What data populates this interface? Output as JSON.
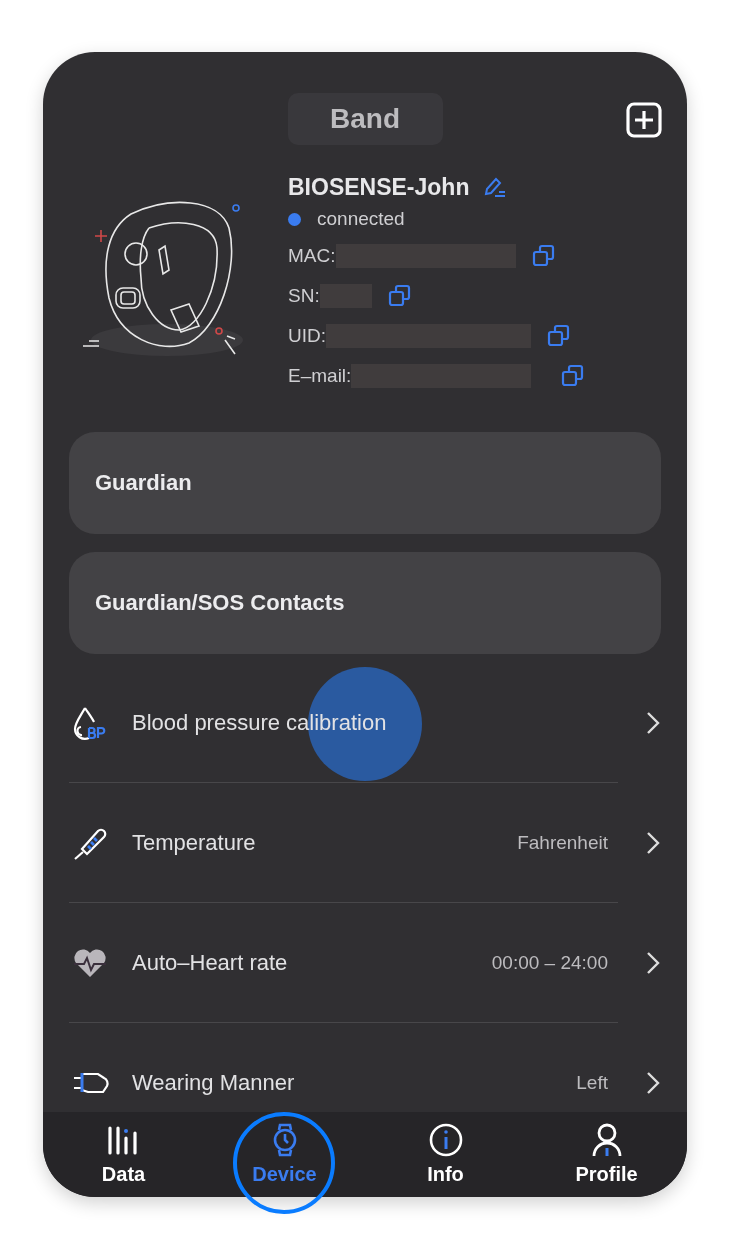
{
  "header": {
    "title": "Band"
  },
  "device": {
    "name": "BIOSENSE-John",
    "status": "connected",
    "connected": true,
    "fields": [
      {
        "label": "MAC:"
      },
      {
        "label": "SN:"
      },
      {
        "label": "UID:"
      },
      {
        "label": "E–mail:"
      }
    ]
  },
  "cards": [
    {
      "label": "Guardian"
    },
    {
      "label": "Guardian/SOS Contacts"
    }
  ],
  "settings": [
    {
      "kind": "blood-pressure",
      "label": "Blood pressure calibration"
    },
    {
      "kind": "temperature",
      "label": "Temperature",
      "value": "Fahrenheit"
    },
    {
      "kind": "heart-rate",
      "label": "Auto–Heart rate",
      "value": "00:00 – 24:00"
    },
    {
      "kind": "wearing",
      "label": "Wearing Manner",
      "value": "Left"
    }
  ],
  "tab_bar": [
    {
      "kind": "data",
      "label": "Data",
      "selected": false
    },
    {
      "kind": "device",
      "label": "Device",
      "selected": true
    },
    {
      "kind": "info",
      "label": "Info",
      "selected": false
    },
    {
      "kind": "profile",
      "label": "Profile",
      "selected": false
    }
  ]
}
